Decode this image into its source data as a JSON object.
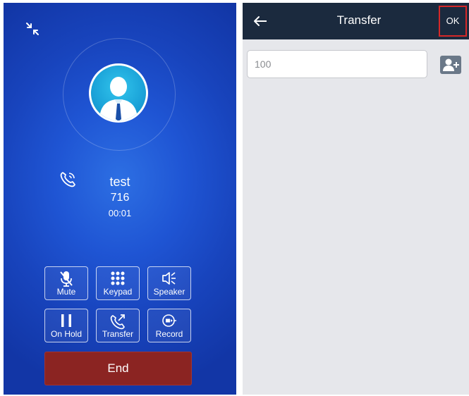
{
  "call": {
    "caller_name": "test",
    "caller_number": "716",
    "timer": "00:01",
    "controls": [
      {
        "label": "Mute"
      },
      {
        "label": "Keypad"
      },
      {
        "label": "Speaker"
      },
      {
        "label": "On Hold"
      },
      {
        "label": "Transfer"
      },
      {
        "label": "Record"
      }
    ],
    "end_label": "End",
    "colors": {
      "background": "#1f55d4",
      "end_button": "#8b2422"
    }
  },
  "transfer": {
    "title": "Transfer",
    "ok_label": "OK",
    "number_value": "100",
    "colors": {
      "header": "#1b2a3e",
      "ok_highlight": "#d62828",
      "body": "#e6e7eb"
    }
  },
  "icons": {
    "collapse": "collapse-arrows-icon",
    "status": "phone-ringing-icon",
    "back": "back-arrow-icon",
    "add_contact": "add-contact-icon"
  }
}
